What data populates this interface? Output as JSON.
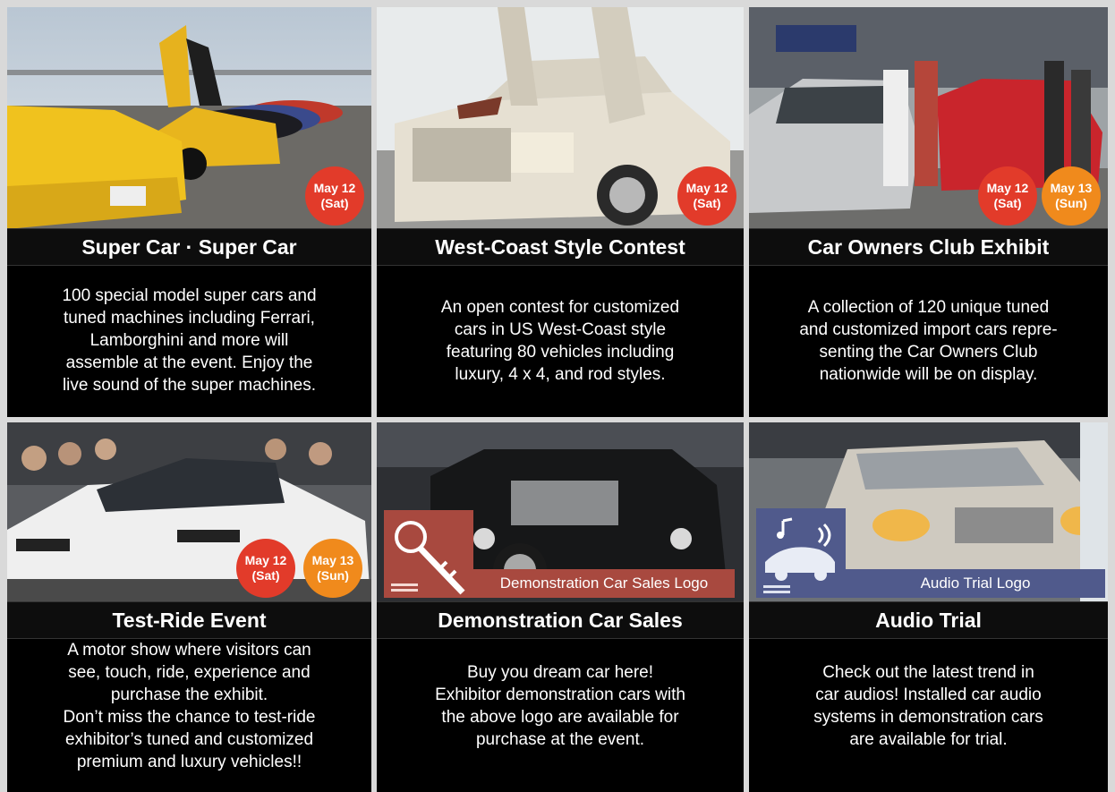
{
  "colors": {
    "badge_sat": "#e23b2a",
    "badge_sun": "#f08a1c",
    "title_bg": "#0d0d0d",
    "desc_bg": "#000000"
  },
  "cards": [
    {
      "title": "Super Car · Super Car",
      "desc": "100 special model super cars and\ntuned machines including Ferrari,\nLamborghini and more will\nassemble at the event.  Enjoy the\nlive sound of the super machines.",
      "badges": [
        {
          "date": "May 12",
          "day": "(Sat)"
        }
      ]
    },
    {
      "title": "West-Coast Style Contest",
      "desc": "An open contest for customized\ncars in US West-Coast style\nfeaturing 80 vehicles including\nluxury, 4 x 4, and rod styles.",
      "badges": [
        {
          "date": "May 12",
          "day": "(Sat)"
        }
      ]
    },
    {
      "title": "Car Owners Club Exhibit",
      "desc": "A collection of 120 unique tuned\nand customized import cars repre-\nsenting the Car Owners Club\nnationwide will be on display.",
      "badges": [
        {
          "date": "May 12",
          "day": "(Sat)"
        },
        {
          "date": "May 13",
          "day": "(Sun)"
        }
      ]
    },
    {
      "title": "Test-Ride Event",
      "desc": "A motor show where visitors can\nsee, touch, ride, experience and\npurchase the exhibit.\nDon’t miss the chance to test-ride\nexhibitor’s tuned and customized\npremium and luxury vehicles!!",
      "badges": [
        {
          "date": "May 12",
          "day": "(Sat)"
        },
        {
          "date": "May 13",
          "day": "(Sun)"
        }
      ]
    },
    {
      "title": "Demonstration Car Sales",
      "desc": "Buy you dream car here!\nExhibitor demonstration cars with\nthe above logo are available for\npurchase at the event.",
      "logo_label": "Demonstration Car Sales Logo",
      "logo_icon": "key-icon"
    },
    {
      "title": "Audio Trial",
      "desc": "Check out the latest trend in\ncar audios!  Installed car audio\nsystems in demonstration cars\nare available for trial.",
      "logo_label": "Audio Trial Logo",
      "logo_icon": "car-audio-icon"
    }
  ]
}
